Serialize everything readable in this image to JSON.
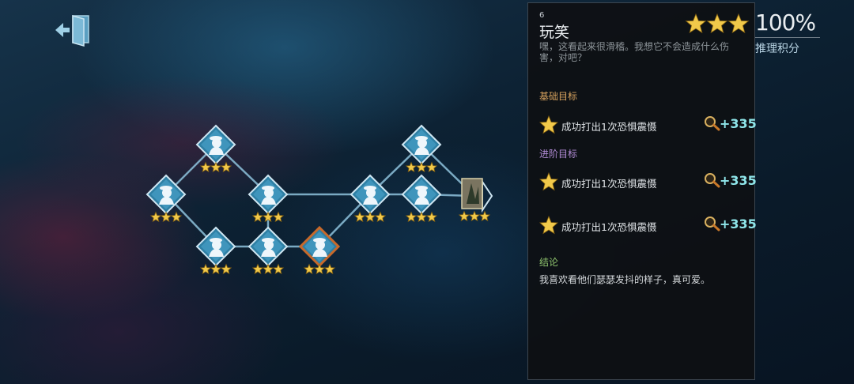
{
  "colors": {
    "star": "#f1c94a",
    "reward": "#8fe6ea",
    "basic_label": "#d9a45f",
    "advanced_label": "#b28cd6",
    "conclusion_label": "#8fc46e"
  },
  "icons": {
    "exit": "exit-door-icon",
    "node": "detective-silhouette-icon",
    "goal": "star-icon",
    "reward": "magnifier-icon"
  },
  "episode": {
    "number": "6",
    "title": "玩笑",
    "description": "嘿，这看起来很滑稽。我想它不会造成什么伤害，对吧？"
  },
  "rating": {
    "stars": 3,
    "percent": "100%",
    "score_label": "推理积分"
  },
  "objectives": {
    "basic_label": "基础目标",
    "basic": [
      {
        "text": "成功打出1次恐惧震慑",
        "reward": "+335",
        "stars": 1
      }
    ],
    "advanced_label": "进阶目标",
    "advanced": [
      {
        "text": "成功打出1次恐惧震慑",
        "reward": "+335",
        "stars": 1
      },
      {
        "text": "成功打出1次恐惧震慑",
        "reward": "+335",
        "stars": 1
      }
    ]
  },
  "conclusion": {
    "label": "结论",
    "text": "我喜欢看他们瑟瑟发抖的样子，真可爱。"
  },
  "map": {
    "nodes": [
      {
        "id": "n1",
        "stars": 3
      },
      {
        "id": "n2",
        "stars": 3
      },
      {
        "id": "n3",
        "stars": 3
      },
      {
        "id": "n4",
        "stars": 3
      },
      {
        "id": "n5",
        "stars": 3
      },
      {
        "id": "n6",
        "stars": 3
      },
      {
        "id": "n7",
        "stars": 3,
        "current": true
      },
      {
        "id": "n8",
        "stars": 3
      },
      {
        "id": "n9",
        "stars": 3
      },
      {
        "id": "n10",
        "stars": 3
      },
      {
        "id": "n11",
        "stars": 3,
        "card": true
      }
    ],
    "links": [
      [
        "n1",
        "n2"
      ],
      [
        "n1",
        "n3"
      ],
      [
        "n2",
        "n4"
      ],
      [
        "n3",
        "n5"
      ],
      [
        "n4",
        "n5"
      ],
      [
        "n4",
        "n8"
      ],
      [
        "n5",
        "n6"
      ],
      [
        "n6",
        "n7"
      ],
      [
        "n7",
        "n8"
      ],
      [
        "n8",
        "n10"
      ],
      [
        "n8",
        "n9"
      ],
      [
        "n9",
        "n11"
      ],
      [
        "n10",
        "n11"
      ]
    ]
  }
}
